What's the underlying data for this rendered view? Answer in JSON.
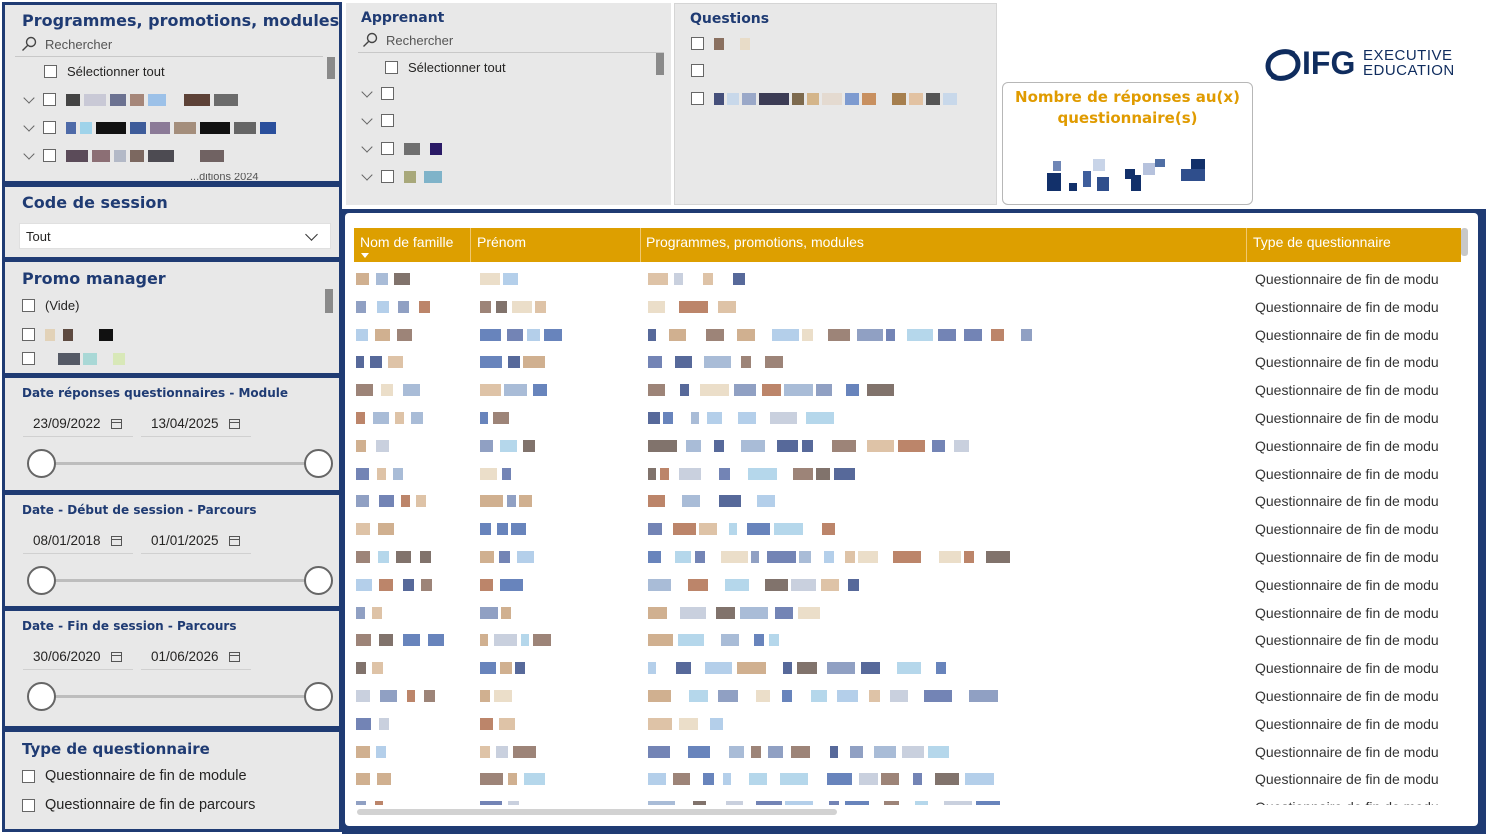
{
  "colors": {
    "navy": "#1f3b73",
    "gold": "#dd9f00",
    "panel": "#e8e8e8"
  },
  "slicer_programmes": {
    "title": "Programmes, promotions, modules",
    "search_placeholder": "Rechercher",
    "select_all": "Sélectionner tout",
    "partial_text": "...ditions 2024"
  },
  "slicer_apprenant": {
    "title": "Apprenant",
    "search_placeholder": "Rechercher",
    "select_all": "Sélectionner tout"
  },
  "slicer_questions": {
    "title": "Questions"
  },
  "logo": {
    "brand": "IFG",
    "line1": "EXECUTIVE",
    "line2": "EDUCATION"
  },
  "kpi": {
    "title": "Nombre de réponses au(x) questionnaire(s)"
  },
  "slicer_session": {
    "title": "Code de session",
    "value": "Tout"
  },
  "slicer_promo": {
    "title": "Promo manager",
    "items": [
      "(Vide)"
    ]
  },
  "date_module": {
    "title": "Date réponses questionnaires - Module",
    "start": "23/09/2022",
    "end": "13/04/2025"
  },
  "date_debut": {
    "title": "Date - Début de session - Parcours",
    "start": "08/01/2018",
    "end": "01/01/2025"
  },
  "date_fin": {
    "title": "Date - Fin de session - Parcours",
    "start": "30/06/2020",
    "end": "01/06/2026"
  },
  "slicer_type": {
    "title": "Type de questionnaire",
    "items": [
      "Questionnaire de fin de module",
      "Questionnaire de fin de parcours"
    ]
  },
  "table": {
    "columns": [
      "Nom de famille",
      "Prénom",
      "Programmes, promotions, modules",
      "Type de questionnaire"
    ],
    "type_value": "Questionnaire de fin de modu",
    "row_count": 20
  }
}
